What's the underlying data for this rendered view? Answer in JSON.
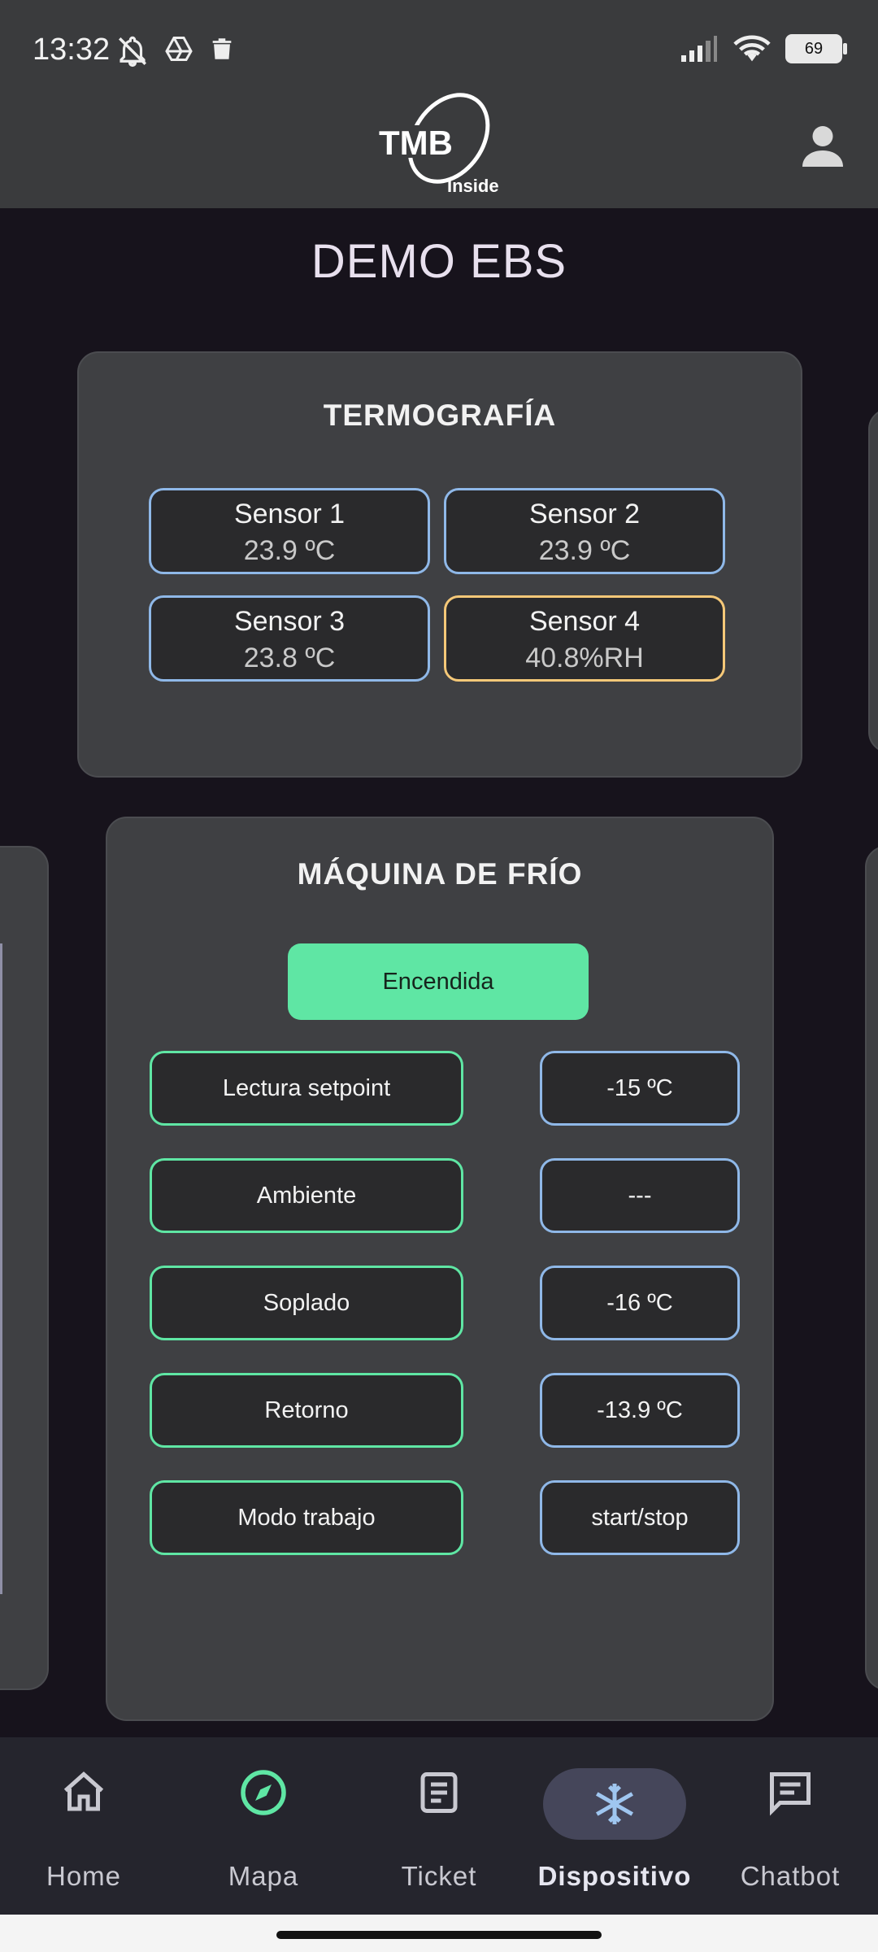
{
  "status_bar": {
    "time": "13:32",
    "battery": "69",
    "icons_left": [
      "bell-off-icon",
      "drive-icon",
      "trash-icon"
    ],
    "icons_right": [
      "signal-icon",
      "wifi-icon",
      "battery-icon"
    ]
  },
  "app_bar": {
    "logo_text": "TMB",
    "logo_subtext": "Inside",
    "user_icon": "user-icon"
  },
  "page": {
    "title": "DEMO EBS"
  },
  "termografia": {
    "title": "TERMOGRAFÍA",
    "sensors": [
      {
        "name": "Sensor 1",
        "value": "23.9 ºC",
        "color": "#8fb8e8"
      },
      {
        "name": "Sensor 2",
        "value": "23.9 ºC",
        "color": "#8fb8e8"
      },
      {
        "name": "Sensor 3",
        "value": "23.8 ºC",
        "color": "#8fb8e8"
      },
      {
        "name": "Sensor 4",
        "value": "40.8%RH",
        "color": "#f5c878"
      }
    ]
  },
  "maquina": {
    "title": "MÁQUINA DE FRÍO",
    "status": "Encendida",
    "status_color": "#5fe6a4",
    "rows": [
      {
        "label": "Lectura setpoint",
        "value": "-15 ºC"
      },
      {
        "label": "Ambiente",
        "value": "---"
      },
      {
        "label": "Soplado",
        "value": "-16 ºC"
      },
      {
        "label": "Retorno",
        "value": "-13.9 ºC"
      },
      {
        "label": "Modo trabajo",
        "value": "start/stop"
      }
    ]
  },
  "nav": {
    "items": [
      {
        "label": "Home",
        "icon": "home-icon"
      },
      {
        "label": "Mapa",
        "icon": "compass-icon"
      },
      {
        "label": "Ticket",
        "icon": "document-icon"
      },
      {
        "label": "Dispositivo",
        "icon": "snowflake-icon",
        "active": true
      },
      {
        "label": "Chatbot",
        "icon": "chat-icon"
      }
    ]
  }
}
